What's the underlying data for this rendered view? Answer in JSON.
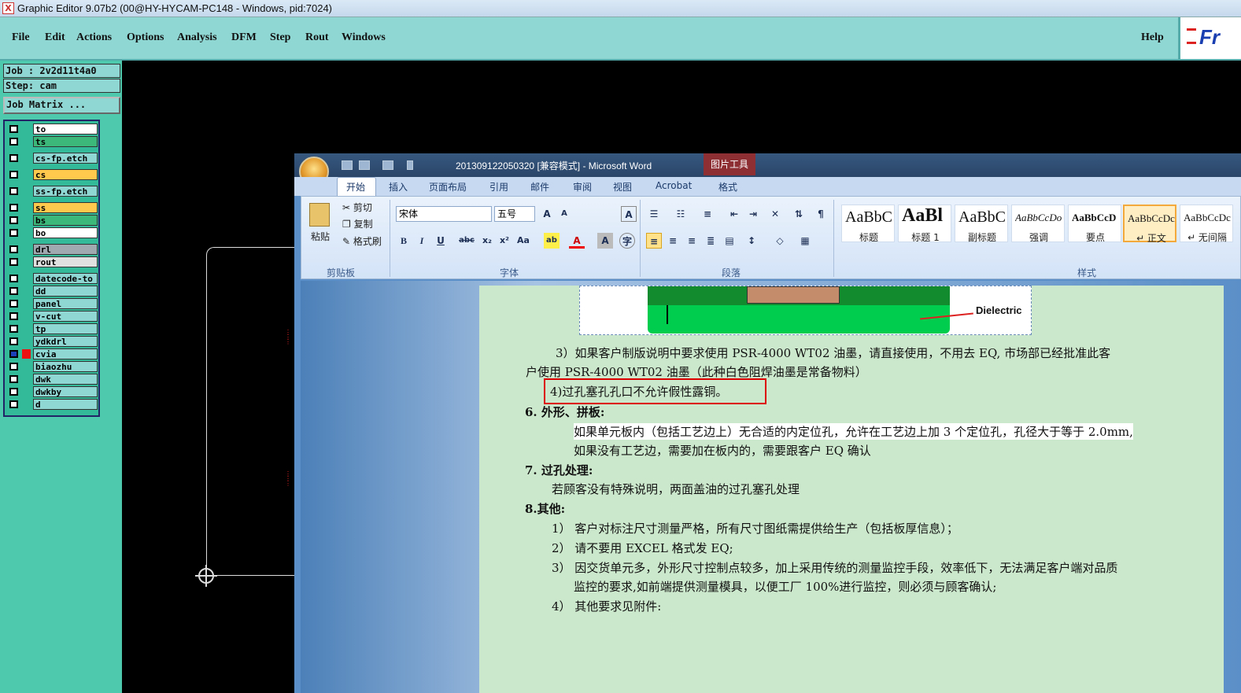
{
  "window": {
    "title": "Graphic Editor 9.07b2 (00@HY-HYCAM-PC148 - Windows, pid:7024)",
    "icon_letter": "X"
  },
  "menubar": {
    "items": [
      "File",
      "Edit",
      "Actions",
      "Options",
      "Analysis",
      "DFM",
      "Step",
      "Rout",
      "Windows"
    ],
    "help": "Help",
    "logo": "Fr"
  },
  "job": {
    "job_label": "Job : 2v2d11t4a0",
    "step_label": "Step: cam",
    "matrix_label": "Job Matrix ..."
  },
  "layers": [
    {
      "name": "to",
      "color": "#ffffff"
    },
    {
      "name": "ts",
      "color": "#3bb87a"
    },
    {
      "name": "cs-fp.etch",
      "color": "#8fd7d3"
    },
    {
      "name": "cs",
      "color": "#ffc94d"
    },
    {
      "name": "ss-fp.etch",
      "color": "#8fd7d3"
    },
    {
      "name": "ss",
      "color": "#ffc94d"
    },
    {
      "name": "bs",
      "color": "#3bb87a"
    },
    {
      "name": "bo",
      "color": "#ffffff"
    },
    {
      "name": "drl",
      "color": "#a0a8b0"
    },
    {
      "name": "rout",
      "color": "#e0e0e0"
    },
    {
      "name": "datecode-to",
      "color": "#8fd7d3"
    },
    {
      "name": "dd",
      "color": "#8fd7d3"
    },
    {
      "name": "panel",
      "color": "#8fd7d3"
    },
    {
      "name": "v-cut",
      "color": "#8fd7d3"
    },
    {
      "name": "tp",
      "color": "#8fd7d3"
    },
    {
      "name": "ydkdrl",
      "color": "#8fd7d3"
    },
    {
      "name": "cvia",
      "color": "#8fd7d3"
    },
    {
      "name": "biaozhu",
      "color": "#8fd7d3"
    },
    {
      "name": "dwk",
      "color": "#8fd7d3"
    },
    {
      "name": "dwkby",
      "color": "#8fd7d3"
    },
    {
      "name": "d",
      "color": "#8fd7d3"
    }
  ],
  "word": {
    "title": "201309122050320 [兼容模式] - Microsoft Word",
    "picture_tools": "图片工具",
    "tabs": [
      "开始",
      "插入",
      "页面布局",
      "引用",
      "邮件",
      "审阅",
      "视图",
      "Acrobat",
      "格式"
    ],
    "clipboard": {
      "paste": "粘贴",
      "cut": "剪切",
      "copy": "复制",
      "format_painter": "格式刷",
      "group": "剪贴板"
    },
    "font": {
      "name": "宋体",
      "size": "五号",
      "group": "字体"
    },
    "paragraph": {
      "group": "段落"
    },
    "styles": {
      "group": "样式",
      "items": [
        {
          "preview": "AaBbC",
          "label": "标题"
        },
        {
          "preview": "AaBl",
          "label": "标题 1"
        },
        {
          "preview": "AaBbC",
          "label": "副标题"
        },
        {
          "preview": "AaBbCcDo",
          "label": "强调"
        },
        {
          "preview": "AaBbCcD",
          "label": "要点"
        },
        {
          "preview": "AaBbCcDc",
          "label": "↵ 正文"
        },
        {
          "preview": "AaBbCcDc",
          "label": "↵ 无间隔"
        }
      ]
    }
  },
  "document": {
    "figure_label": "Dielectric",
    "p3_line1": "3）如果客户制版说明中要求使用 PSR-4000 WT02 油墨，请直接使用，不用去 EQ, 市场部已经批准此客",
    "p3_line2": "户使用 PSR-4000 WT02 油墨（此种白色阻焊油墨是常备物料）",
    "p4": "4)过孔塞孔孔口不允许假性露铜。",
    "h6": "6.   外形、拼板:",
    "p6_line1": "如果单元板内（包括工艺边上）无合适的内定位孔，允许在工艺边上加 3 个定位孔，孔径大于等于 2.0mm,",
    "p6_line2": "如果没有工艺边，需要加在板内的，需要跟客户 EQ 确认",
    "h7": "7. 过孔处理:",
    "p7": "若顾客没有特殊说明，两面盖油的过孔塞孔处理",
    "h8": "8.其他:",
    "p8_1": "1）  客户对标注尺寸测量严格，所有尺寸图纸需提供给生产（包括板厚信息）；",
    "p8_2": "2）  请不要用 EXCEL 格式发 EQ;",
    "p8_3a": "3）  因交货单元多，外形尺寸控制点较多，加上采用传统的测量监控手段，效率低下，无法满足客户端对品质",
    "p8_3b": "监控的要求,如前端提供测量模具，以便工厂 100%进行监控，则必须与顾客确认;",
    "p8_4": "4）  其他要求见附件:"
  }
}
